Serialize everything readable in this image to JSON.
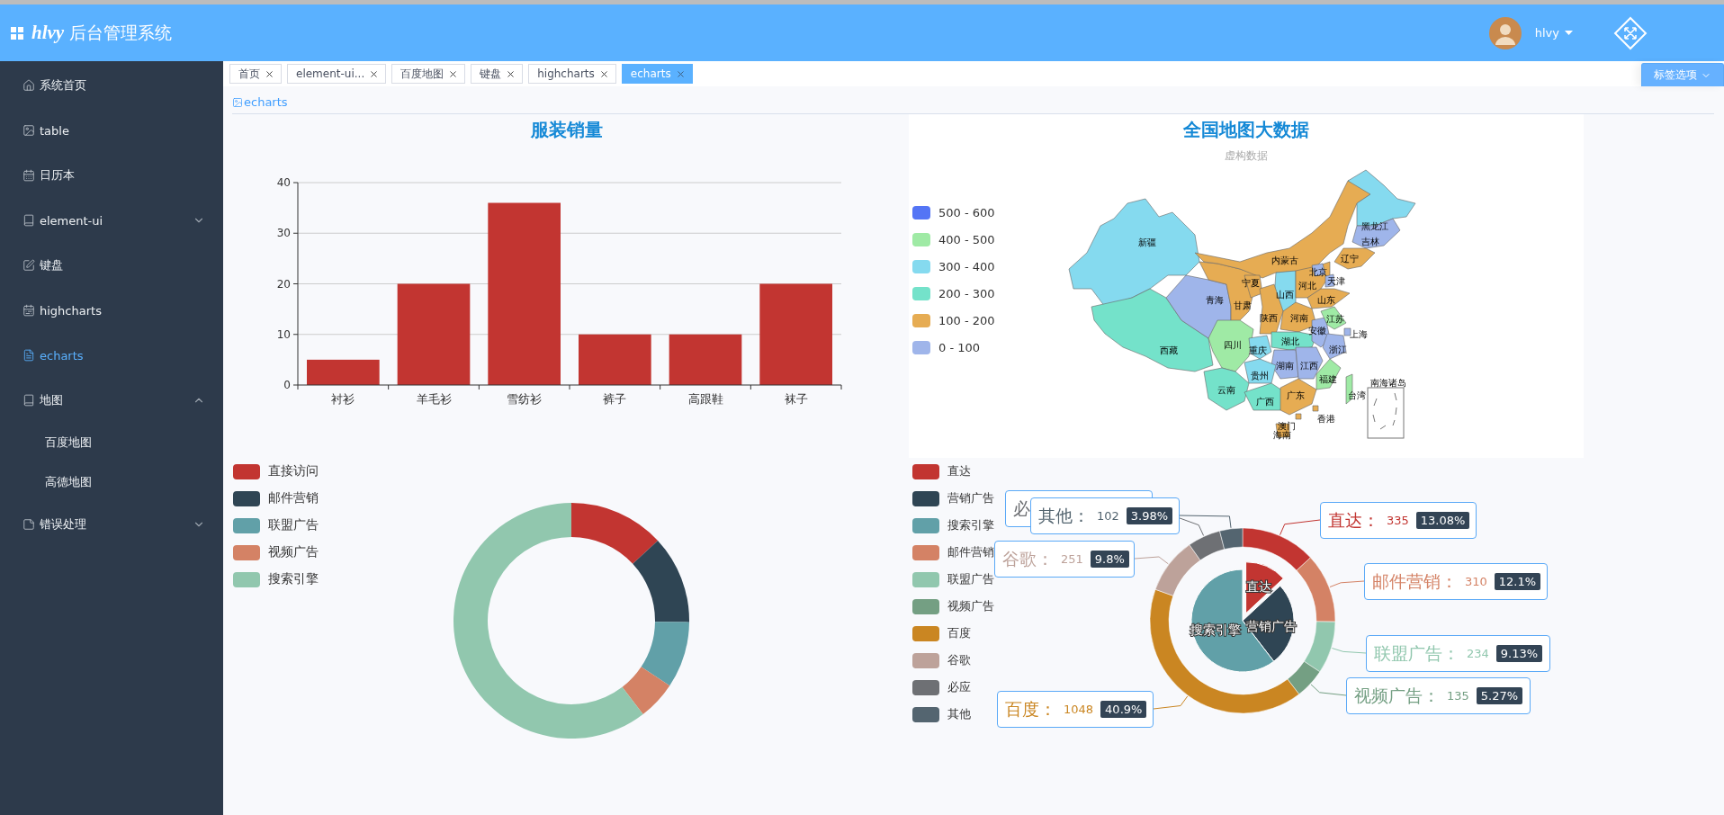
{
  "header": {
    "brand": "hlvy",
    "title": "后台管理系统",
    "user": "hlvy"
  },
  "sidebar": {
    "items": [
      {
        "label": "系统首页",
        "selected": false
      },
      {
        "label": "table",
        "selected": false
      },
      {
        "label": "日历本",
        "selected": false
      },
      {
        "label": "element-ui",
        "selected": false,
        "expanded": false
      },
      {
        "label": "键盘",
        "selected": false
      },
      {
        "label": "highcharts",
        "selected": false
      },
      {
        "label": "echarts",
        "selected": true
      },
      {
        "label": "地图",
        "selected": false,
        "expanded": true,
        "children": [
          {
            "label": "百度地图",
            "selected": false
          },
          {
            "label": "高德地图",
            "selected": false
          }
        ]
      },
      {
        "label": "错误处理",
        "selected": false,
        "expanded": false
      }
    ]
  },
  "tabs": [
    {
      "label": "首页",
      "selected": false
    },
    {
      "label": "element-ui...",
      "selected": false
    },
    {
      "label": "百度地图",
      "selected": false
    },
    {
      "label": "键盘",
      "selected": false
    },
    {
      "label": "highcharts",
      "selected": false
    },
    {
      "label": "echarts",
      "selected": true
    }
  ],
  "tab_options": "标签选项",
  "breadcrumb": "echarts",
  "bar_panel": {
    "title": "服装销量",
    "chart_data": {
      "type": "bar",
      "categories": [
        "衬衫",
        "羊毛衫",
        "雪纺衫",
        "裤子",
        "高跟鞋",
        "袜子"
      ],
      "series": [
        {
          "color": "#c23531",
          "values": [
            5,
            20,
            36,
            10,
            10,
            20
          ]
        }
      ],
      "ylim": [
        0,
        40
      ],
      "yticks": [
        0,
        10,
        20,
        30,
        40
      ],
      "grid": true
    }
  },
  "map": {
    "title": "全国地图大数据",
    "subtitle": "虚构数据",
    "legend": [
      {
        "label": "500 - 600",
        "color": "#5475f5"
      },
      {
        "label": "400 - 500",
        "color": "#9feaa5"
      },
      {
        "label": "300 - 400",
        "color": "#85daef"
      },
      {
        "label": "200 - 300",
        "color": "#74e2ca"
      },
      {
        "label": "100 - 200",
        "color": "#e6ac53"
      },
      {
        "label": "0 - 100",
        "color": "#9fb5ea"
      }
    ],
    "regions": [
      {
        "name": "新疆",
        "kind": "province",
        "color": "#85daef"
      },
      {
        "name": "西藏",
        "kind": "province",
        "color": "#74e2ca"
      },
      {
        "name": "青海",
        "kind": "province",
        "color": "#9fb5ea"
      },
      {
        "name": "甘肃",
        "kind": "province",
        "color": "#e6ac53"
      },
      {
        "name": "内蒙古",
        "kind": "province",
        "color": "#e6ac53"
      },
      {
        "name": "黑龙江",
        "kind": "province",
        "color": "#85daef"
      },
      {
        "name": "吉林",
        "kind": "province",
        "color": "#9fb5ea"
      },
      {
        "name": "辽宁",
        "kind": "province",
        "color": "#e6ac53"
      },
      {
        "name": "宁夏",
        "kind": "province",
        "color": "#e6ac53"
      },
      {
        "name": "山西",
        "kind": "province",
        "color": "#85daef"
      },
      {
        "name": "河北",
        "kind": "province",
        "color": "#e6ac53"
      },
      {
        "name": "北京",
        "kind": "province",
        "color": "#9fb5ea"
      },
      {
        "name": "天津",
        "kind": "province",
        "color": "#9fb5ea"
      },
      {
        "name": "山东",
        "kind": "province",
        "color": "#e6ac53"
      },
      {
        "name": "陕西",
        "kind": "province",
        "color": "#e6ac53"
      },
      {
        "name": "河南",
        "kind": "province",
        "color": "#e6ac53"
      },
      {
        "name": "四川",
        "kind": "province",
        "color": "#9feaa5"
      },
      {
        "name": "重庆",
        "kind": "province",
        "color": "#85daef"
      },
      {
        "name": "湖北",
        "kind": "province",
        "color": "#74e2ca"
      },
      {
        "name": "安徽",
        "kind": "province",
        "color": "#9fb5ea"
      },
      {
        "name": "江苏",
        "kind": "province",
        "color": "#9feaa5"
      },
      {
        "name": "上海",
        "kind": "province",
        "color": "#9fb5ea"
      },
      {
        "name": "浙江",
        "kind": "province",
        "color": "#9fb5ea"
      },
      {
        "name": "湖南",
        "kind": "province",
        "color": "#9fb5ea"
      },
      {
        "name": "江西",
        "kind": "province",
        "color": "#9fb5ea"
      },
      {
        "name": "贵州",
        "kind": "province",
        "color": "#85daef"
      },
      {
        "name": "云南",
        "kind": "province",
        "color": "#74e2ca"
      },
      {
        "name": "福建",
        "kind": "province",
        "color": "#9feaa5"
      },
      {
        "name": "台湾",
        "kind": "province",
        "color": "#9feaa5"
      },
      {
        "name": "广西",
        "kind": "province",
        "color": "#74e2ca"
      },
      {
        "name": "广东",
        "kind": "province",
        "color": "#e6ac53"
      },
      {
        "name": "海南",
        "kind": "province",
        "color": "#e6ac53"
      },
      {
        "name": "香港",
        "kind": "province",
        "color": "#e6ac53"
      },
      {
        "name": "澳门",
        "kind": "province",
        "color": "#e6ac53"
      },
      {
        "name": "南海诸岛",
        "kind": "inset"
      }
    ]
  },
  "donut_panel": {
    "chart_data": {
      "type": "donut",
      "categories": [
        "直接访问",
        "邮件营销",
        "联盟广告",
        "视频广告",
        "搜索引擎"
      ],
      "values": [
        13.1,
        12.1,
        9.1,
        5.3,
        60.4
      ],
      "colors": [
        "#c23531",
        "#2f4554",
        "#61a0a8",
        "#d48265",
        "#91c7ae"
      ]
    }
  },
  "nested_panel": {
    "legend": [
      {
        "label": "直达",
        "color": "#c23531"
      },
      {
        "label": "营销广告",
        "color": "#2f4554"
      },
      {
        "label": "搜索引擎",
        "color": "#61a0a8"
      },
      {
        "label": "邮件营销",
        "color": "#d48265"
      },
      {
        "label": "联盟广告",
        "color": "#91c7ae"
      },
      {
        "label": "视频广告",
        "color": "#749f83"
      },
      {
        "label": "百度",
        "color": "#ca8622"
      },
      {
        "label": "谷歌",
        "color": "#bda29a"
      },
      {
        "label": "必应",
        "color": "#6e7074"
      },
      {
        "label": "其他",
        "color": "#546570"
      }
    ],
    "chart_data": {
      "type": "donut",
      "series": [
        {
          "values": [
            13.08,
            26.5,
            60.42
          ],
          "colors": [
            "#c23531",
            "#2f4554",
            "#61a0a8"
          ]
        },
        {
          "values": [
            13.08,
            12.1,
            9.13,
            5.27,
            40.9,
            9.8,
            5.74,
            3.98
          ],
          "colors": [
            "#c23531",
            "#d48265",
            "#91c7ae",
            "#749f83",
            "#ca8622",
            "#bda29a",
            "#6e7074",
            "#546570"
          ]
        }
      ]
    },
    "inner_selected": [
      true,
      false,
      false
    ],
    "inner_labels": [
      "直达",
      "营销广告",
      "搜索引擎"
    ],
    "outer_labels": [
      {
        "title": "必",
        "color": "#6e7074"
      },
      {
        "title": "其他：",
        "value": "102",
        "percent": "3.98%",
        "color": "#546570"
      },
      {
        "title": "直达：",
        "value": "335",
        "percent": "13.08%",
        "color": "#c23531"
      },
      {
        "title": "谷歌：",
        "value": "251",
        "percent": "9.8%",
        "color": "#bda29a"
      },
      {
        "title": "邮件营销：",
        "value": "310",
        "percent": "12.1%",
        "color": "#d48265"
      },
      {
        "title": "联盟广告：",
        "value": "234",
        "percent": "9.13%",
        "color": "#91c7ae"
      },
      {
        "title": "视频广告：",
        "value": "135",
        "percent": "5.27%",
        "color": "#749f83"
      },
      {
        "title": "百度：",
        "value": "1048",
        "percent": "40.9%",
        "color": "#ca8622"
      }
    ]
  }
}
